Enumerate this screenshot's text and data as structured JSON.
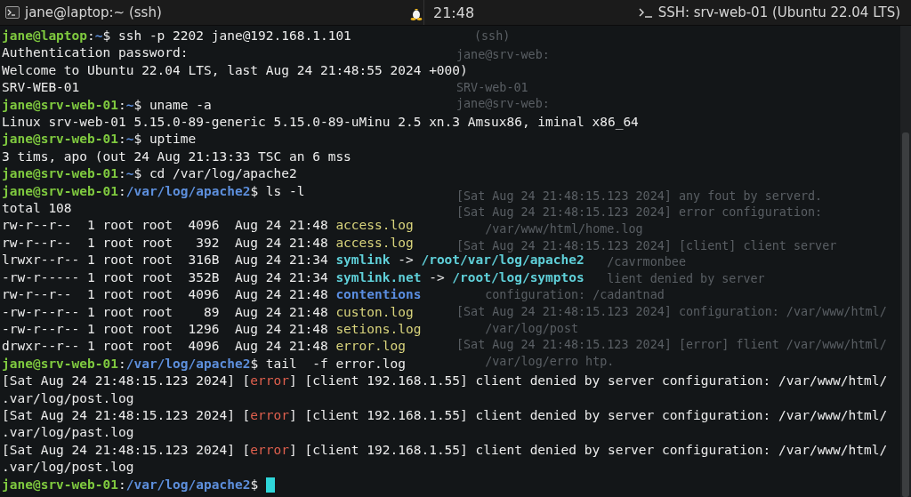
{
  "title_bar": {
    "left_title": "jane@laptop:~ (ssh)",
    "clock": "21:48",
    "right_title": "SSH: srv-web-01 (Ubuntu 22.04 LTS)"
  },
  "terminal": {
    "lines": [
      {
        "segments": [
          {
            "kind": "user",
            "text": "jane@laptop"
          },
          {
            "kind": "plain",
            "text": ":"
          },
          {
            "kind": "path",
            "text": "~"
          },
          {
            "kind": "plain",
            "text": "$ ssh -p 2202 jane@192.168.1.101"
          }
        ]
      },
      {
        "segments": [
          {
            "kind": "plain",
            "text": "Authentication password:"
          }
        ]
      },
      {
        "segments": [
          {
            "kind": "plain",
            "text": "Welcome to Ubuntu 22.04 LTS, last Aug 24 21:48:55 2024 +000)"
          }
        ]
      },
      {
        "segments": [
          {
            "kind": "plain",
            "text": "SRV-WEB-01"
          }
        ]
      },
      {
        "segments": [
          {
            "kind": "user",
            "text": "jane@srv-web-01"
          },
          {
            "kind": "plain",
            "text": ":"
          },
          {
            "kind": "path",
            "text": "~"
          },
          {
            "kind": "plain",
            "text": "$ uname -a"
          }
        ]
      },
      {
        "segments": [
          {
            "kind": "plain",
            "text": "Linux srv-web-01 5.15.0-89-generic 5.15.0-89-uMinu 2.5 xn.3 Amsux86, iminal x86_64"
          }
        ]
      },
      {
        "segments": [
          {
            "kind": "user",
            "text": "jane@srv-web-01"
          },
          {
            "kind": "plain",
            "text": ":"
          },
          {
            "kind": "path",
            "text": "~"
          },
          {
            "kind": "plain",
            "text": "$ uptime"
          }
        ]
      },
      {
        "segments": [
          {
            "kind": "plain",
            "text": "3 tims, apo (out 24 Aug 21:13:33 TSC an 6 mss"
          }
        ]
      },
      {
        "segments": [
          {
            "kind": "user",
            "text": "jane@srv-web-01"
          },
          {
            "kind": "plain",
            "text": ":"
          },
          {
            "kind": "path",
            "text": "~"
          },
          {
            "kind": "plain",
            "text": "$ cd /var/log/apache2"
          }
        ]
      },
      {
        "segments": [
          {
            "kind": "user",
            "text": "jane@srv-web-01"
          },
          {
            "kind": "plain",
            "text": ":"
          },
          {
            "kind": "path",
            "text": "/var/log/apache2"
          },
          {
            "kind": "plain",
            "text": "$ ls -l"
          }
        ]
      },
      {
        "segments": [
          {
            "kind": "plain",
            "text": "total 108"
          }
        ]
      },
      {
        "segments": [
          {
            "kind": "plain",
            "text": "rw-r--r--  1 root root  4096  Aug 24 21:48 "
          },
          {
            "kind": "file",
            "text": "access.log"
          }
        ]
      },
      {
        "segments": [
          {
            "kind": "plain",
            "text": "rw-r--r--  1 root root   392  Aug 24 21:48 "
          },
          {
            "kind": "file",
            "text": "access.log"
          }
        ]
      },
      {
        "segments": [
          {
            "kind": "plain",
            "text": "lrwxr--r-- 1 root root  316B  Aug 24 21:34 "
          },
          {
            "kind": "link",
            "text": "symlink"
          },
          {
            "kind": "plain",
            "text": " -> "
          },
          {
            "kind": "link",
            "text": "/root/var/log/apache2"
          }
        ]
      },
      {
        "segments": [
          {
            "kind": "plain",
            "text": "-rw-r----- 1 root root  352B  Aug 24 21:34 "
          },
          {
            "kind": "link",
            "text": "symlink.net"
          },
          {
            "kind": "plain",
            "text": " -> "
          },
          {
            "kind": "link",
            "text": "/root/log/symptos"
          }
        ]
      },
      {
        "segments": [
          {
            "kind": "plain",
            "text": "rw-r--r--  1 root root  4096  Aug 24 21:48 "
          },
          {
            "kind": "dir",
            "text": "contentions"
          }
        ]
      },
      {
        "segments": [
          {
            "kind": "plain",
            "text": "-rw-r--r-- 1 root root    89  Aug 24 21:48 "
          },
          {
            "kind": "file",
            "text": "custon.log"
          }
        ]
      },
      {
        "segments": [
          {
            "kind": "plain",
            "text": "-rw-r--r-- 1 root root  1296  Aug 24 21:48 "
          },
          {
            "kind": "file",
            "text": "setions.log"
          }
        ]
      },
      {
        "segments": [
          {
            "kind": "plain",
            "text": "drwxr--r-- 1 root root  4096  Aug 24 21:48 "
          },
          {
            "kind": "file",
            "text": "error.log"
          }
        ]
      },
      {
        "segments": [
          {
            "kind": "user",
            "text": "jane@srv-web-01"
          },
          {
            "kind": "plain",
            "text": ":"
          },
          {
            "kind": "path",
            "text": "/var/log/apache2"
          },
          {
            "kind": "plain",
            "text": "$ tail  -f error.log"
          }
        ]
      },
      {
        "segments": [
          {
            "kind": "plain",
            "text": "[Sat Aug 24 21:48:15.123 2024] ["
          },
          {
            "kind": "error",
            "text": "error"
          },
          {
            "kind": "plain",
            "text": "] [client 192.168.1.55] client denied by server configuration: /var/www/html/"
          }
        ]
      },
      {
        "segments": [
          {
            "kind": "plain",
            "text": ".var/log/post.log"
          }
        ]
      },
      {
        "segments": [
          {
            "kind": "plain",
            "text": "[Sat Aug 24 21:48:15.123 2024] ["
          },
          {
            "kind": "error",
            "text": "error"
          },
          {
            "kind": "plain",
            "text": "] [client 192.168.1.55] client denied by server configuration: /var/www/html/"
          }
        ]
      },
      {
        "segments": [
          {
            "kind": "plain",
            "text": ".var/log/past.log"
          }
        ]
      },
      {
        "segments": [
          {
            "kind": "plain",
            "text": "[Sat Aug 24 21:48:15.123 2024] ["
          },
          {
            "kind": "error",
            "text": "error"
          },
          {
            "kind": "plain",
            "text": "] [client 192.168.1.55] client denied by server configuration: /var/www/html/"
          }
        ]
      },
      {
        "segments": [
          {
            "kind": "plain",
            "text": ".var/log/post.log"
          }
        ]
      },
      {
        "segments": [
          {
            "kind": "user",
            "text": "jane@srv-web-01"
          },
          {
            "kind": "plain",
            "text": ":"
          },
          {
            "kind": "path",
            "text": "/var/log/apache2"
          },
          {
            "kind": "plain",
            "text": "$ "
          }
        ],
        "cursor": true
      }
    ]
  },
  "ghost_window": {
    "title": "(ssh)",
    "header_lines": [
      "jane@srv-web:",
      "SRV-web-01",
      "jane@srv-web:"
    ],
    "log_lines": [
      {
        "kind": "entry",
        "text": "[Sat Aug 24 21:48:15.123 2024] any fout by serverd."
      },
      {
        "kind": "entry",
        "text": "[Sat Aug 24 21:48:15.123 2024] error configuration:"
      },
      {
        "kind": "continuation",
        "text": "/var/www/html/home.log"
      },
      {
        "kind": "entry",
        "text": "[Sat Aug 24 21:48:15.123 2024] [client] client server"
      },
      {
        "kind": "tail",
        "text": "/cavrmonbee"
      },
      {
        "kind": "tail",
        "text": "lient denied by server"
      },
      {
        "kind": "continuation",
        "text": "configuration: /cadantnad"
      },
      {
        "kind": "entry",
        "text": "[Sat Aug 24 21:48:15.123 2024] configuration: /var/www/html/"
      },
      {
        "kind": "continuation",
        "text": "/var/log/post"
      },
      {
        "kind": "entry",
        "text": "[Sat Aug 24 21:48:15.123 2024] [error] flient /var/www/html/"
      },
      {
        "kind": "continuation",
        "text": "/var/log/erro htp."
      }
    ]
  }
}
